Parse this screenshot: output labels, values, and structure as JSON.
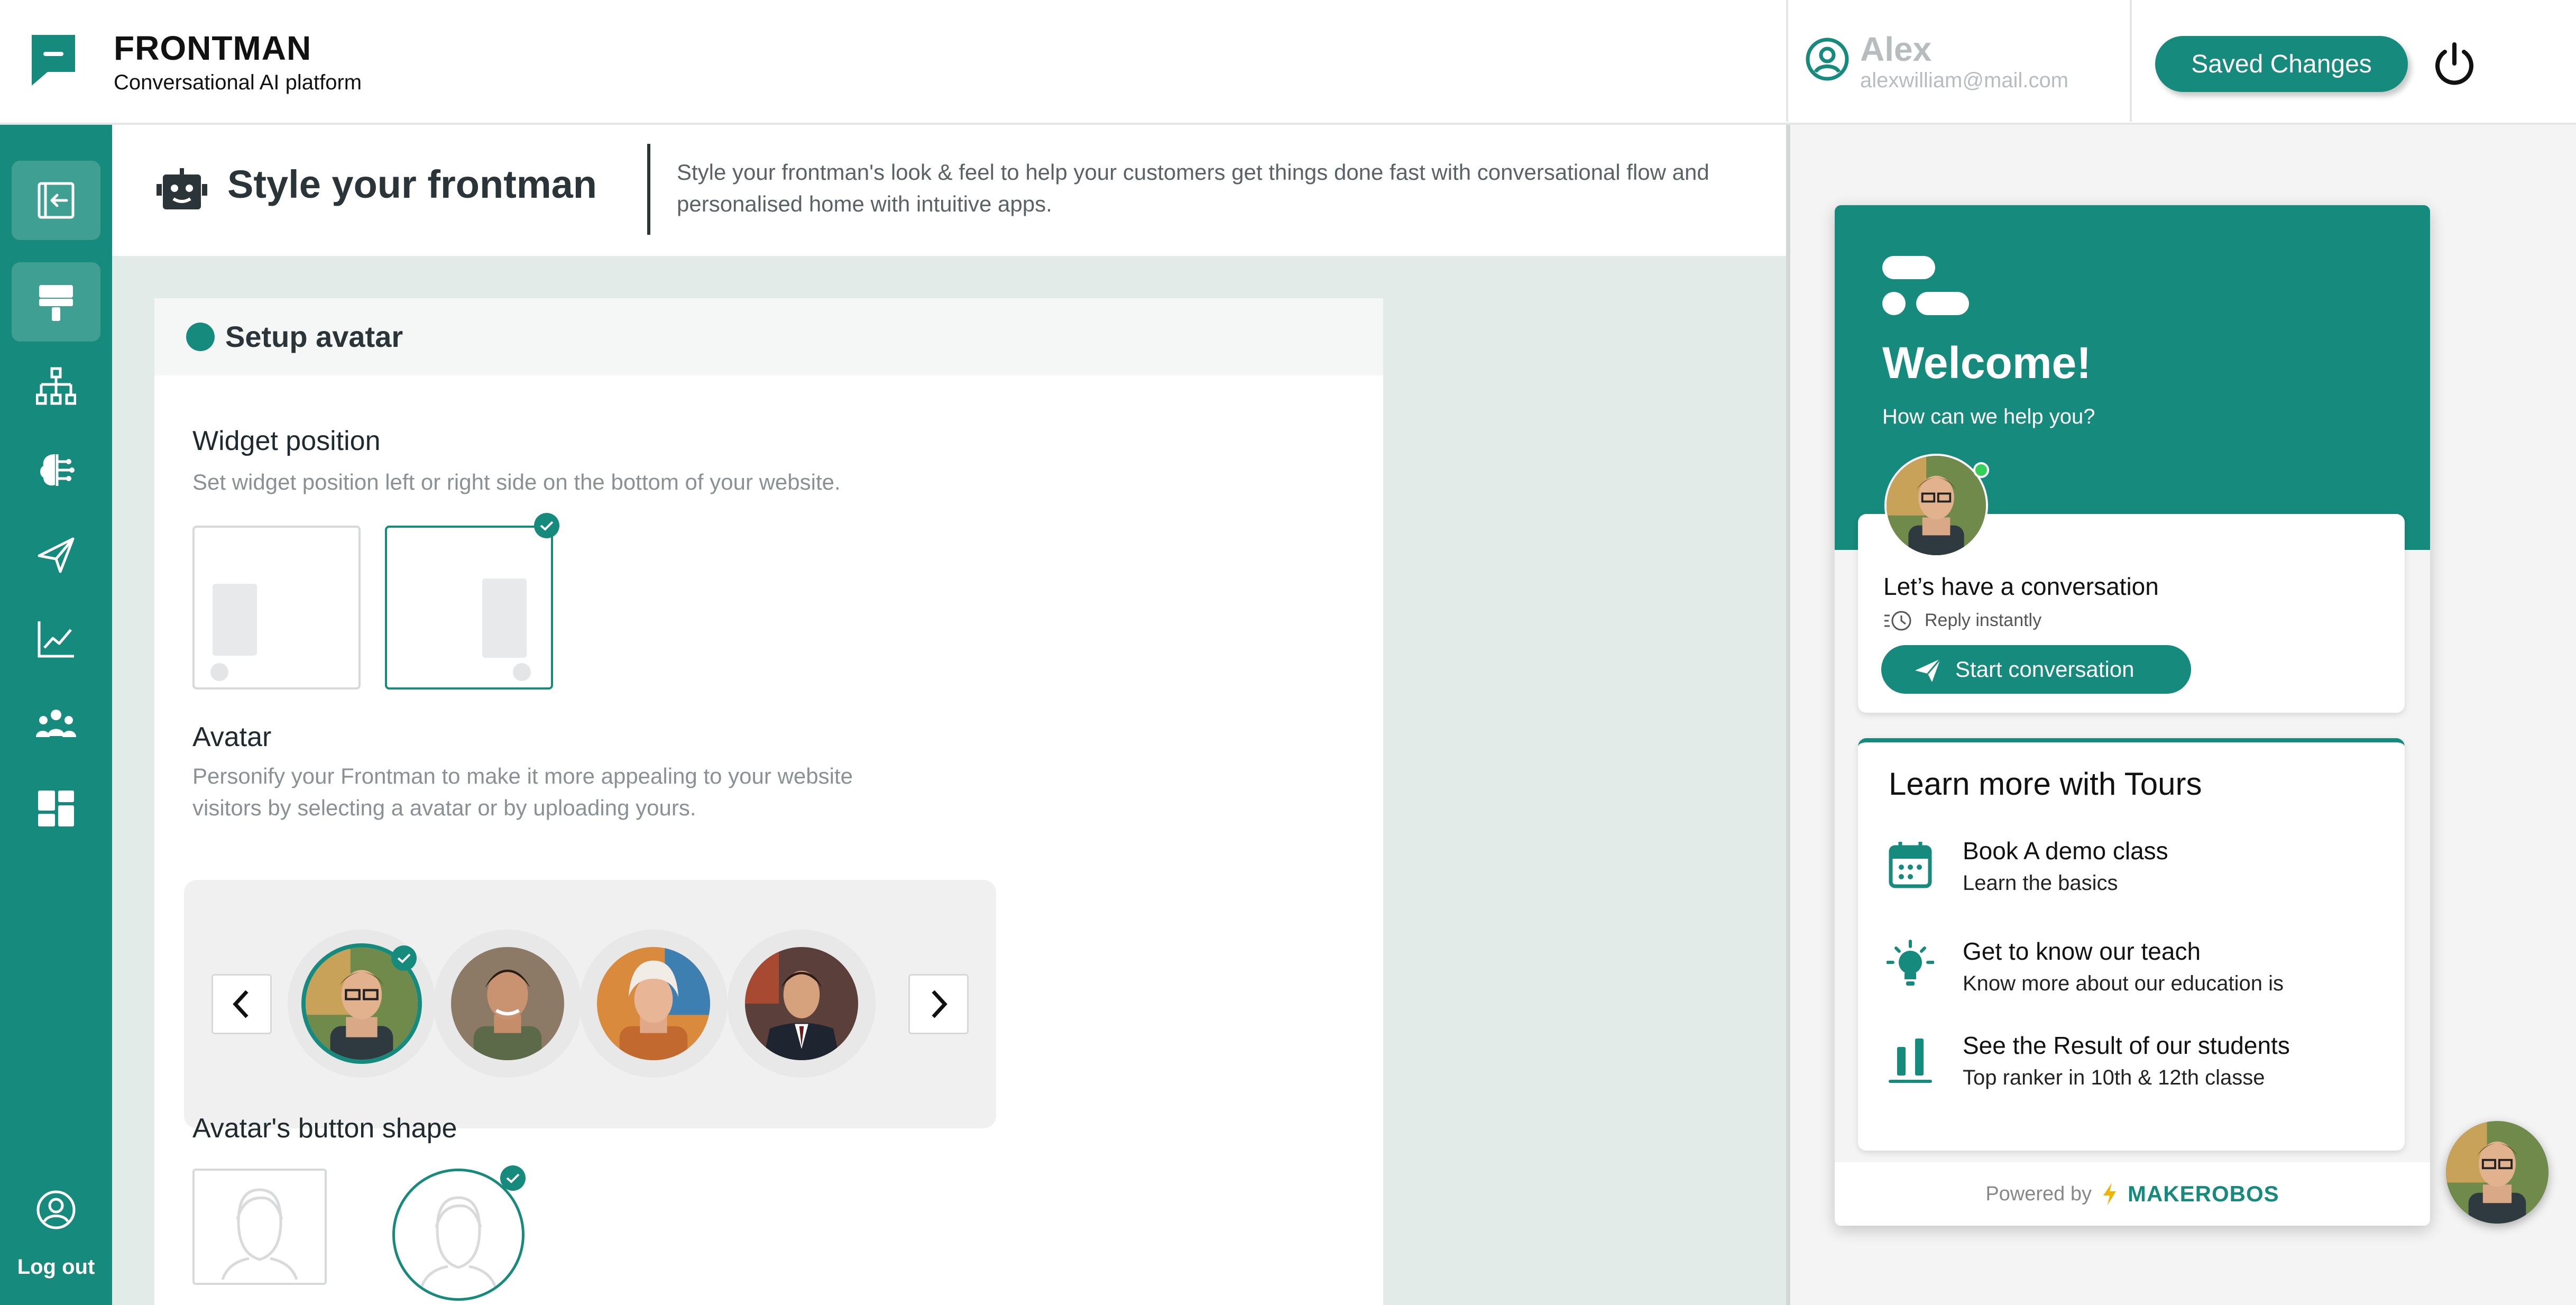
{
  "brand": {
    "name": "FRONTMAN",
    "subtitle": "Conversational AI platform"
  },
  "user": {
    "name": "Alex",
    "email": "alexwilliam@mail.com"
  },
  "header": {
    "save_label": "Saved Changes"
  },
  "sidebar": {
    "items": [
      {
        "name": "collapse",
        "icon": "collapse-arrow-icon"
      },
      {
        "name": "style",
        "icon": "paint-roller-icon",
        "active": true
      },
      {
        "name": "flow",
        "icon": "org-chart-icon"
      },
      {
        "name": "brain",
        "icon": "brain-icon"
      },
      {
        "name": "send",
        "icon": "paper-plane-icon"
      },
      {
        "name": "analytics",
        "icon": "line-chart-icon"
      },
      {
        "name": "team",
        "icon": "users-icon"
      },
      {
        "name": "apps",
        "icon": "dashboard-icon"
      }
    ],
    "logout_label": "Log out"
  },
  "page": {
    "title": "Style your frontman",
    "description": "Style your frontman's look & feel to help your customers get things done fast with conversational flow and personalised home with intuitive apps."
  },
  "setup": {
    "card_title": "Setup avatar",
    "widget_position": {
      "title": "Widget position",
      "subtitle": "Set widget position left or right side on the bottom of your website.",
      "options": [
        "left",
        "right"
      ],
      "selected": "right"
    },
    "avatar": {
      "title": "Avatar",
      "subtitle": "Personify your Frontman to make it more appealing to your website visitors by selecting a avatar or by uploading yours.",
      "options": [
        "avatar-1",
        "avatar-2",
        "avatar-3",
        "avatar-4"
      ],
      "selected": "avatar-1"
    },
    "button_shape": {
      "title": "Avatar's button shape",
      "options": [
        "square",
        "circle"
      ],
      "selected": "circle"
    }
  },
  "preview": {
    "welcome": "Welcome!",
    "help": "How can we help you?",
    "conversation_title": "Let’s have a conversation",
    "reply_text": "Reply instantly",
    "start_label": "Start conversation",
    "tours_title": "Learn more with Tours",
    "tours": [
      {
        "icon": "calendar-icon",
        "title": "Book A demo class",
        "subtitle": "Learn the basics"
      },
      {
        "icon": "lightbulb-icon",
        "title": "Get to know our teach",
        "subtitle": "Know more about our education is"
      },
      {
        "icon": "bar-chart-icon",
        "title": "See the Result of our students",
        "subtitle": "Top ranker in 10th & 12th classe"
      }
    ],
    "powered_by": "Powered by",
    "powered_brand": "MAKEROBOS"
  },
  "colors": {
    "accent": "#168a7c",
    "online": "#34d058"
  }
}
